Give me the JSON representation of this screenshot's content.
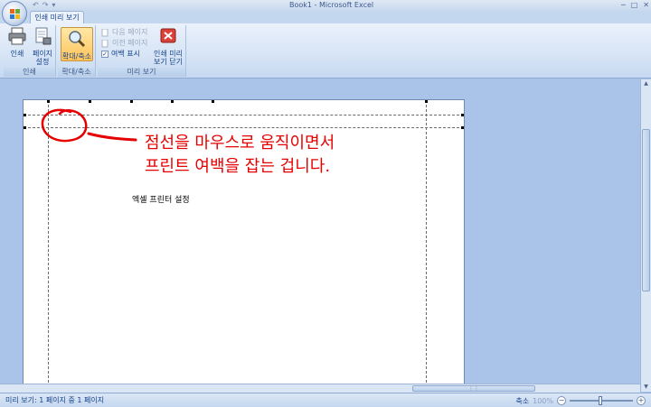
{
  "window": {
    "title": "Book1 - Microsoft Excel",
    "minimize": "─",
    "maximize": "□",
    "close": "✕"
  },
  "quick_access": [
    "↶",
    "↷",
    "▾"
  ],
  "tab": {
    "label": "인쇄 미리 보기"
  },
  "ribbon": {
    "print_group": {
      "label": "인쇄",
      "print_label": "인쇄",
      "page_setup_label_1": "페이지",
      "page_setup_label_2": "설정"
    },
    "zoom_group": {
      "label": "확대/축소",
      "zoom_label": "확대/축소"
    },
    "preview_group": {
      "label": "미리 보기",
      "next_page": "다음 페이지",
      "prev_page": "이전 페이지",
      "show_margins": "여백 표시",
      "show_margins_checked": "✓",
      "close_label_1": "인쇄 미리",
      "close_label_2": "보기 닫기"
    }
  },
  "page": {
    "text": "엑셀 프린터 설정"
  },
  "annotation": {
    "line1": "점선을 마우스로 움직이면서",
    "line2": "프린트 여백을 잡는 겁니다.",
    "color": "#e60000"
  },
  "status": {
    "text": "미리 보기: 1 페이지 중 1 페이지",
    "zoom_label": "축소",
    "zoom_percent": "100%",
    "zoom_minus": "−",
    "zoom_plus": "+"
  },
  "colors": {
    "workspace": "#a9c4e8",
    "ribbon": "#d6e4f5",
    "active_button": "#ffc45a"
  }
}
